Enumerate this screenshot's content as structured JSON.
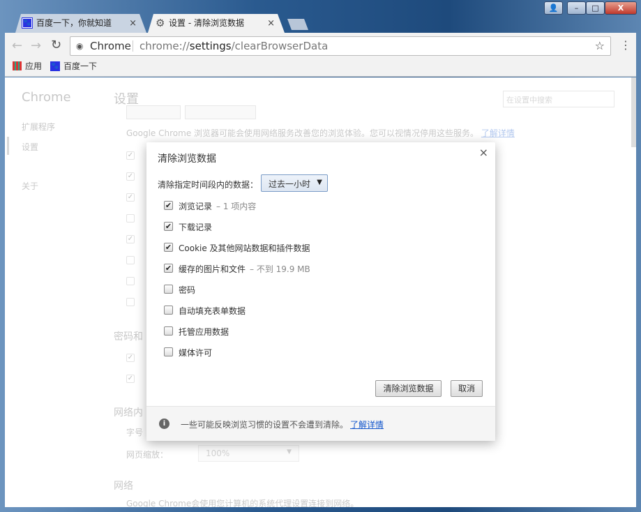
{
  "window": {
    "user_icon": "user-icon",
    "minimize": "–",
    "maximize": "□",
    "close": "X"
  },
  "tabs": [
    {
      "label": "百度一下，你就知道",
      "icon": "baidu-paw-icon",
      "close": "×"
    },
    {
      "label": "设置 - 清除浏览数据",
      "icon": "gear-icon",
      "close": "×"
    }
  ],
  "omnibox": {
    "site_label": "Chrome",
    "url_prefix": "chrome://",
    "url_host": "settings",
    "url_path": "/clearBrowserData"
  },
  "bookmarks": [
    {
      "label": "应用",
      "icon": "apps-grid-icon"
    },
    {
      "label": "百度一下",
      "icon": "baidu-paw-icon"
    }
  ],
  "sidebar": {
    "brand": "Chrome",
    "items": [
      "扩展程序",
      "设置",
      "关于"
    ]
  },
  "settings": {
    "title": "设置",
    "search_placeholder": "在设置中搜索",
    "privacy_desc": "Google Chrome 浏览器可能会使用网络服务改善您的浏览体验。您可以视情况停用这些服务。",
    "learn_more": "了解详情",
    "passwords_heading": "密码和",
    "web_content_heading": "网络内",
    "font_size_label": "字号",
    "zoom_label": "网页缩放：",
    "zoom_value": "100%",
    "network_heading": "网络",
    "network_desc": "Google Chrome会使用您计算机的系统代理设置连接到网络。"
  },
  "dialog": {
    "title": "清除浏览数据",
    "close": "×",
    "range_label": "清除指定时间段内的数据：",
    "range_value": "过去一小时",
    "items": [
      {
        "label": "浏览记录",
        "note": "– 1 项内容",
        "checked": true
      },
      {
        "label": "下载记录",
        "note": "",
        "checked": true
      },
      {
        "label": "Cookie 及其他网站数据和插件数据",
        "note": "",
        "checked": true
      },
      {
        "label": "缓存的图片和文件",
        "note": "– 不到 19.9 MB",
        "checked": true
      },
      {
        "label": "密码",
        "note": "",
        "checked": false
      },
      {
        "label": "自动填充表单数据",
        "note": "",
        "checked": false
      },
      {
        "label": "托管应用数据",
        "note": "",
        "checked": false
      },
      {
        "label": "媒体许可",
        "note": "",
        "checked": false
      }
    ],
    "clear_button": "清除浏览数据",
    "cancel_button": "取消",
    "footer_text": "一些可能反映浏览习惯的设置不会遭到清除。",
    "footer_link": "了解详情"
  }
}
